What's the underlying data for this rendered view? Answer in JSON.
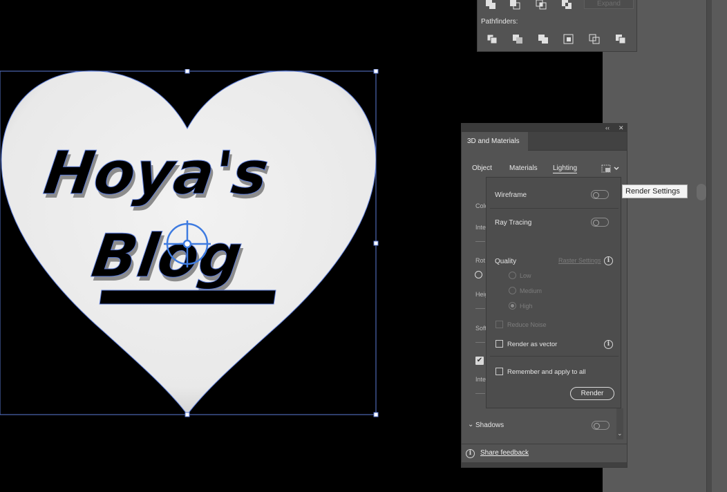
{
  "pathfinder": {
    "expand_label": "Expand",
    "pathfinders_label": "Pathfinders:"
  },
  "artwork": {
    "line1": "Hoya's",
    "line2": "Blog"
  },
  "panel3d": {
    "title": "3D and Materials",
    "tabs": [
      "Object",
      "Materials",
      "Lighting"
    ],
    "active_tab": "Lighting",
    "bg_labels": [
      "Colo",
      "Inte",
      "Rot",
      "Heig",
      "Soft",
      "Inte"
    ],
    "shadows_label": "Shadows",
    "share_feedback": "Share feedback"
  },
  "render_settings": {
    "wireframe_label": "Wireframe",
    "ray_tracing_label": "Ray Tracing",
    "quality_label": "Quality",
    "raster_settings_label": "Raster Settings",
    "quality_options": [
      "Low",
      "Medium",
      "High"
    ],
    "quality_selected": "High",
    "reduce_noise_label": "Reduce Noise",
    "render_as_vector_label": "Render as vector",
    "remember_label": "Remember and apply to all",
    "render_button": "Render"
  },
  "tooltip": {
    "text": "Render Settings"
  },
  "colors": {
    "selection": "#5b7bd6",
    "panel_bg": "#535353",
    "popup_bg": "#4d4d4d"
  }
}
